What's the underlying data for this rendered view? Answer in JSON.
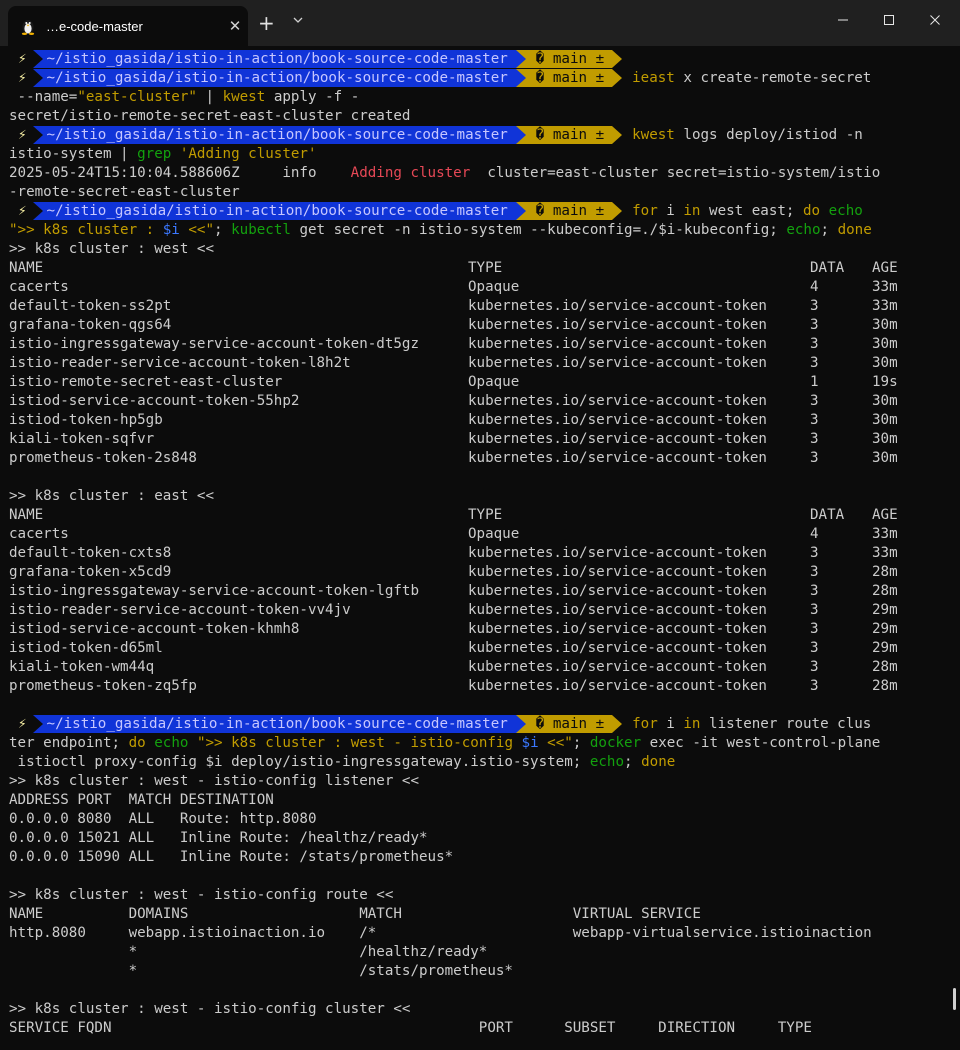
{
  "tab": {
    "title": "…e-code-master",
    "close": "✕",
    "new_tab": "+"
  },
  "prompt": {
    "bolt": "⚡",
    "path": "~/istio_gasida/istio-in-action/book-source-code-master",
    "branch": "� main ±"
  },
  "cmds": {
    "c1": {
      "a": "ieast",
      "b": " x create-remote-secret"
    },
    "c1b": {
      "a": " --name=",
      "b": "\"east-cluster\"",
      "c": " | ",
      "d": "kwest",
      "e": " apply -f -"
    },
    "c1c": "secret/istio-remote-secret-east-cluster created",
    "c2": {
      "a": "kwest",
      "b": " logs deploy/istiod -n"
    },
    "c2b": {
      "a": "istio-system | ",
      "b": "grep",
      "c": " 'Adding cluster'"
    },
    "log1": {
      "a": "2025-05-24T15:10:04.588606Z     info    ",
      "b": "Adding cluster",
      "c": "  cluster=east-cluster secret=istio-system/istio"
    },
    "log2": "-remote-secret-east-cluster",
    "c3": {
      "a": "for",
      "b": " i ",
      "c": "in",
      "d": " west east; ",
      "e": "do",
      "f": " echo"
    },
    "c3b": {
      "a": "\">> k8s cluster : ",
      "b": "$i",
      "c": " <<\"",
      "d": "; ",
      "e": "kubectl",
      "f": " get secret -n istio-system --kubeconfig=./$i-kubeconfig; ",
      "g": "echo",
      "h": "; ",
      "i": "done"
    },
    "c4": {
      "a": "for",
      "b": " i ",
      "c": "in",
      "d": " listener route clus"
    },
    "c4b": {
      "a": "ter endpoint; ",
      "b": "do",
      "c": " ",
      "d": "echo",
      "e": " \">> k8s cluster : west - istio-config ",
      "f": "$i",
      "g": " <<\"",
      "h": "; ",
      "i": "docker",
      "j": " exec -it west-control-plane"
    },
    "c4c": {
      "a": " istioctl proxy-config $i deploy/istio-ingressgateway.istio-system; ",
      "b": "echo",
      "c": "; ",
      "d": "done"
    }
  },
  "west_secrets": {
    "header": ">> k8s cluster : west <<",
    "columns": [
      "NAME",
      "TYPE",
      "DATA",
      "AGE"
    ],
    "rows": [
      [
        "cacerts",
        "Opaque",
        "4",
        "33m"
      ],
      [
        "default-token-ss2pt",
        "kubernetes.io/service-account-token",
        "3",
        "33m"
      ],
      [
        "grafana-token-qgs64",
        "kubernetes.io/service-account-token",
        "3",
        "30m"
      ],
      [
        "istio-ingressgateway-service-account-token-dt5gz",
        "kubernetes.io/service-account-token",
        "3",
        "30m"
      ],
      [
        "istio-reader-service-account-token-l8h2t",
        "kubernetes.io/service-account-token",
        "3",
        "30m"
      ],
      [
        "istio-remote-secret-east-cluster",
        "Opaque",
        "1",
        "19s"
      ],
      [
        "istiod-service-account-token-55hp2",
        "kubernetes.io/service-account-token",
        "3",
        "30m"
      ],
      [
        "istiod-token-hp5gb",
        "kubernetes.io/service-account-token",
        "3",
        "30m"
      ],
      [
        "kiali-token-sqfvr",
        "kubernetes.io/service-account-token",
        "3",
        "30m"
      ],
      [
        "prometheus-token-2s848",
        "kubernetes.io/service-account-token",
        "3",
        "30m"
      ]
    ]
  },
  "east_secrets": {
    "header": ">> k8s cluster : east <<",
    "columns": [
      "NAME",
      "TYPE",
      "DATA",
      "AGE"
    ],
    "rows": [
      [
        "cacerts",
        "Opaque",
        "4",
        "33m"
      ],
      [
        "default-token-cxts8",
        "kubernetes.io/service-account-token",
        "3",
        "33m"
      ],
      [
        "grafana-token-x5cd9",
        "kubernetes.io/service-account-token",
        "3",
        "28m"
      ],
      [
        "istio-ingressgateway-service-account-token-lgftb",
        "kubernetes.io/service-account-token",
        "3",
        "28m"
      ],
      [
        "istio-reader-service-account-token-vv4jv",
        "kubernetes.io/service-account-token",
        "3",
        "29m"
      ],
      [
        "istiod-service-account-token-khmh8",
        "kubernetes.io/service-account-token",
        "3",
        "29m"
      ],
      [
        "istiod-token-d65ml",
        "kubernetes.io/service-account-token",
        "3",
        "29m"
      ],
      [
        "kiali-token-wm44q",
        "kubernetes.io/service-account-token",
        "3",
        "28m"
      ],
      [
        "prometheus-token-zq5fp",
        "kubernetes.io/service-account-token",
        "3",
        "28m"
      ]
    ]
  },
  "listener": {
    "header": ">> k8s cluster : west - istio-config listener <<",
    "lines": [
      "ADDRESS PORT  MATCH DESTINATION",
      "0.0.0.0 8080  ALL   Route: http.8080",
      "0.0.0.0 15021 ALL   Inline Route: /healthz/ready*",
      "0.0.0.0 15090 ALL   Inline Route: /stats/prometheus*"
    ]
  },
  "route": {
    "header": ">> k8s cluster : west - istio-config route <<",
    "lines": [
      "NAME          DOMAINS                    MATCH                    VIRTUAL SERVICE",
      "http.8080     webapp.istioinaction.io    /*                       webapp-virtualservice.istioinaction",
      "              *                          /healthz/ready*",
      "              *                          /stats/prometheus*"
    ]
  },
  "cluster": {
    "header": ">> k8s cluster : west - istio-config cluster <<",
    "columns_line": "SERVICE FQDN                                           PORT      SUBSET     DIRECTION     TYPE"
  }
}
